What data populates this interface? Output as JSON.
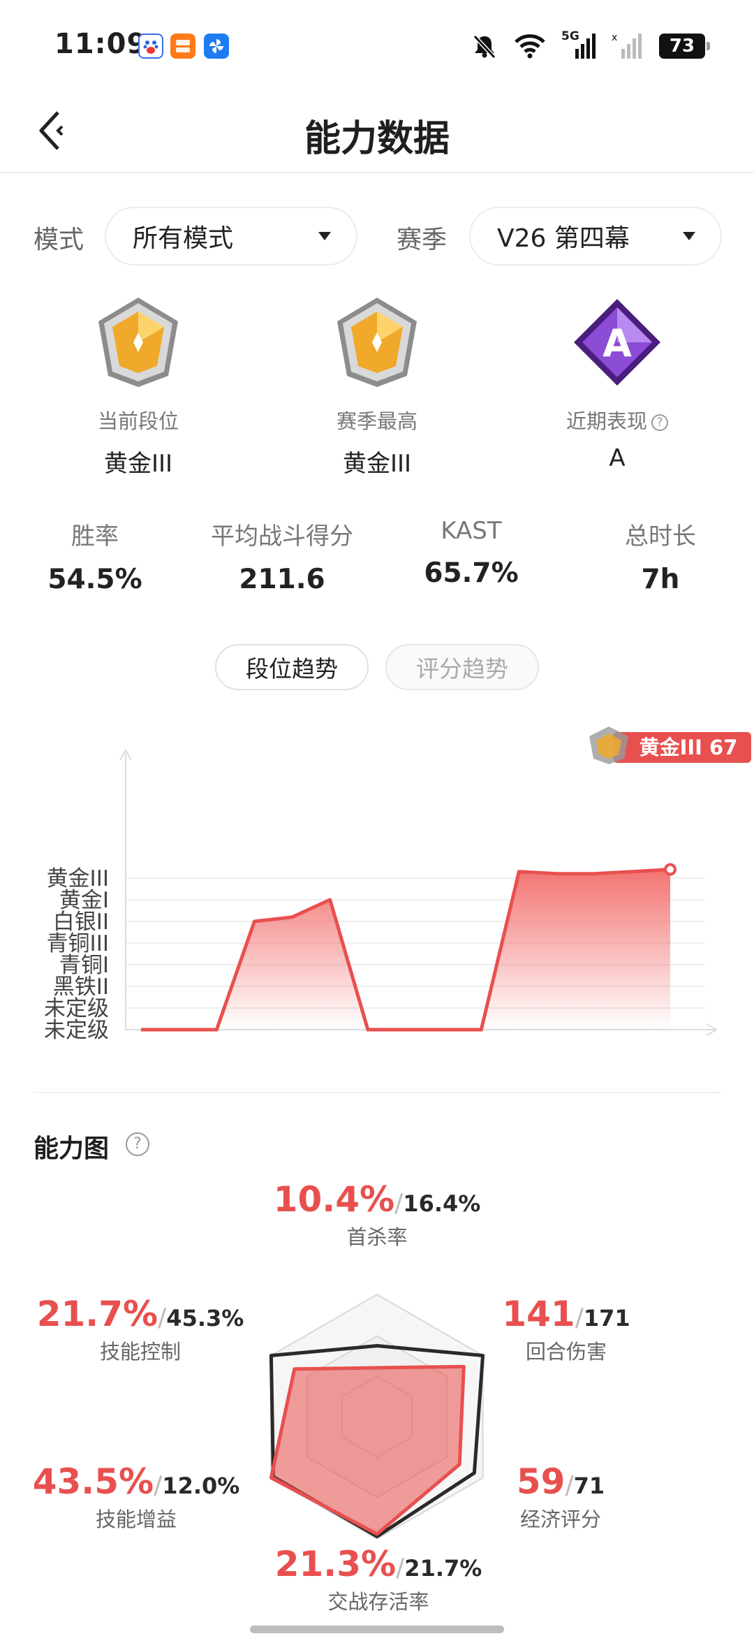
{
  "status_bar": {
    "time": "11:09",
    "app_icons": [
      "baidu-app-icon",
      "taobao-app-icon",
      "pinwheel-app-icon"
    ],
    "icons": [
      "bell-muted-icon",
      "wifi-icon",
      "signal-5g-icon",
      "signal-icon",
      "battery-icon"
    ],
    "network_label": "5G",
    "battery": "73"
  },
  "nav": {
    "title": "能力数据"
  },
  "filters": {
    "mode_label": "模式",
    "mode_value": "所有模式",
    "season_label": "赛季",
    "season_value": "V26 第四幕"
  },
  "ranks": [
    {
      "label": "当前段位",
      "value": "黄金III",
      "icon": "gold-rank-badge-icon"
    },
    {
      "label": "赛季最高",
      "value": "黄金III",
      "icon": "gold-rank-badge-icon"
    },
    {
      "label": "近期表现",
      "value": "A",
      "icon": "a-grade-badge-icon"
    }
  ],
  "stats": [
    {
      "label": "胜率",
      "value": "54.5%"
    },
    {
      "label": "平均战斗得分",
      "value": "211.6"
    },
    {
      "label": "KAST",
      "value": "65.7%"
    },
    {
      "label": "总时长",
      "value": "7h"
    }
  ],
  "tabs": [
    {
      "label": "段位趋势",
      "active": true
    },
    {
      "label": "评分趋势",
      "active": false
    }
  ],
  "chart_data": {
    "type": "area",
    "y_levels": [
      "未定级",
      "未定级",
      "黑铁II",
      "青铜I",
      "青铜III",
      "白银II",
      "黄金I",
      "黄金III"
    ],
    "values": [
      0,
      0,
      0,
      5.0,
      5.2,
      6.0,
      0,
      0,
      0,
      0,
      7.3,
      7.2,
      7.2,
      7.3,
      7.4
    ],
    "latest_badge": "黄金III 67",
    "grid": true,
    "colors": {
      "line": "#e8504f",
      "fill": "#f26d6b"
    }
  },
  "ability": {
    "title": "能力图",
    "metrics": [
      {
        "key": "first_kill",
        "label": "首杀率",
        "value": "10.4%",
        "compare": "16.4%",
        "player": 0.4,
        "reference": 0.58
      },
      {
        "key": "round_damage",
        "label": "回合伤害",
        "value": "141",
        "compare": "171",
        "player": 0.82,
        "reference": 1.0
      },
      {
        "key": "economy",
        "label": "经济评分",
        "value": "59",
        "compare": "71",
        "player": 0.78,
        "reference": 0.92
      },
      {
        "key": "survival",
        "label": "交战存活率",
        "value": "21.3%",
        "compare": "21.7%",
        "player": 0.96,
        "reference": 0.98
      },
      {
        "key": "skill_buff",
        "label": "技能增益",
        "value": "43.5%",
        "compare": "12.0%",
        "player": 1.0,
        "reference": 0.98
      },
      {
        "key": "skill_control",
        "label": "技能控制",
        "value": "21.7%",
        "compare": "45.3%",
        "player": 0.78,
        "reference": 1.0
      }
    ],
    "colors": {
      "player": "#e8504f",
      "reference": "#2a2a2a"
    }
  }
}
